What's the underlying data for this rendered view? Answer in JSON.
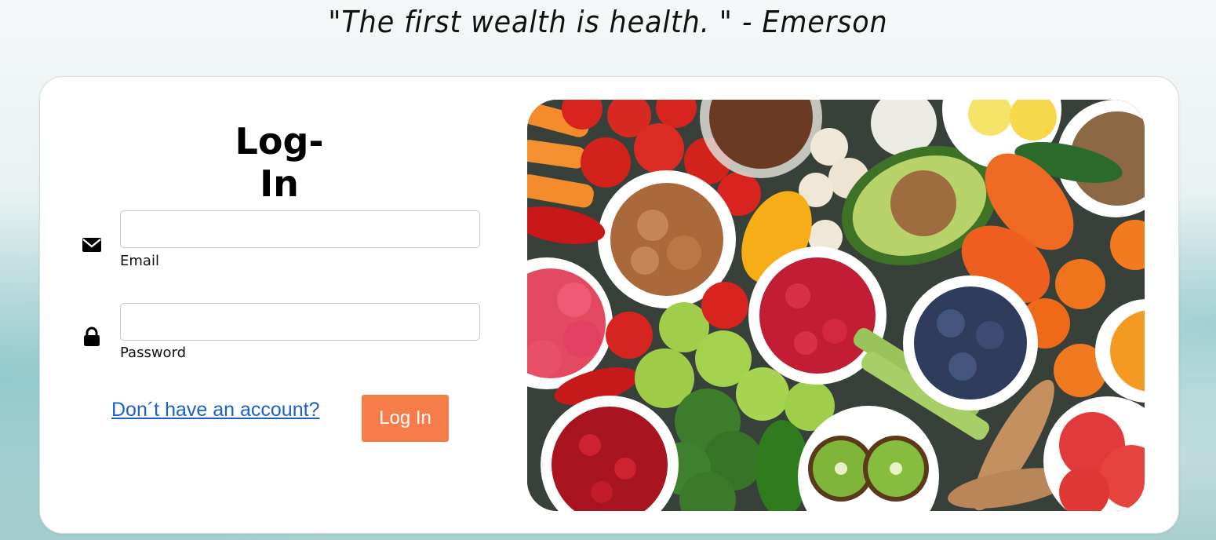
{
  "quote": "\"The first wealth is health. \" - Emerson",
  "login": {
    "title": "Log-In",
    "email_label": "Email",
    "email_value": "",
    "password_label": "Password",
    "password_value": "",
    "signup_link": "Don´t have an account?",
    "submit_label": "Log In"
  },
  "icons": {
    "email": "envelope-icon",
    "password": "lock-icon"
  },
  "colors": {
    "button": "#f67d4a",
    "link": "#1a62c9"
  }
}
